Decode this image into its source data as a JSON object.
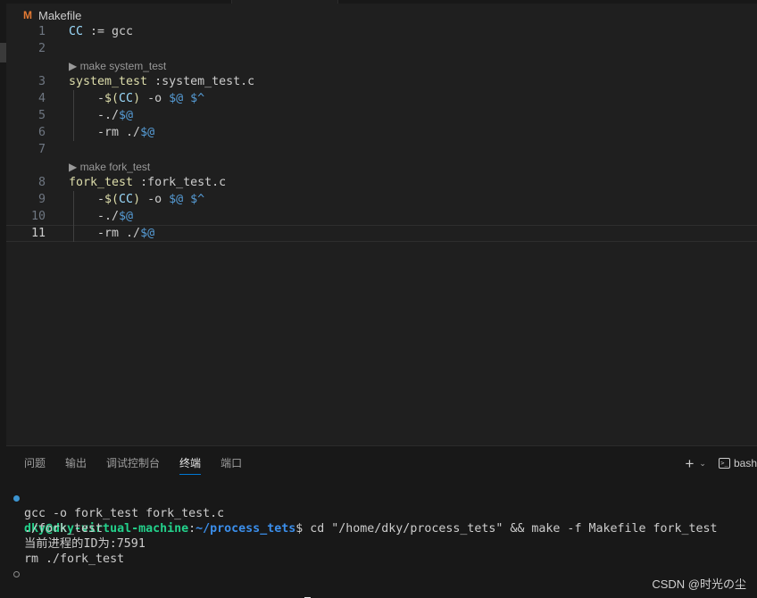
{
  "editor": {
    "file_name": "Makefile",
    "file_icon_letter": "M",
    "lines": [
      {
        "n": "1",
        "segments": [
          {
            "t": "CC",
            "c": "c-blue"
          },
          {
            "t": " := ",
            "c": "c-text"
          },
          {
            "t": "gcc",
            "c": "c-text"
          }
        ]
      },
      {
        "n": "2",
        "segments": []
      },
      {
        "n": "3",
        "lens": "make system_test",
        "segments": [
          {
            "t": "system_test",
            "c": "c-yellow"
          },
          {
            "t": " :",
            "c": "c-text"
          },
          {
            "t": "system_test.c",
            "c": "c-text"
          }
        ]
      },
      {
        "n": "4",
        "segments": [
          {
            "t": "    -",
            "c": "c-dash"
          },
          {
            "t": "$(",
            "c": "c-yellow"
          },
          {
            "t": "CC",
            "c": "c-blue"
          },
          {
            "t": ")",
            "c": "c-yellow"
          },
          {
            "t": " -o ",
            "c": "c-text"
          },
          {
            "t": "$@",
            "c": "c-dblue"
          },
          {
            "t": " ",
            "c": "c-text"
          },
          {
            "t": "$^",
            "c": "c-dblue"
          }
        ]
      },
      {
        "n": "5",
        "segments": [
          {
            "t": "    -",
            "c": "c-dash"
          },
          {
            "t": "./",
            "c": "c-text"
          },
          {
            "t": "$@",
            "c": "c-dblue"
          }
        ]
      },
      {
        "n": "6",
        "segments": [
          {
            "t": "    -",
            "c": "c-dash"
          },
          {
            "t": "rm ./",
            "c": "c-text"
          },
          {
            "t": "$@",
            "c": "c-dblue"
          }
        ]
      },
      {
        "n": "7",
        "segments": []
      },
      {
        "n": "8",
        "lens": "make fork_test",
        "segments": [
          {
            "t": "fork_test",
            "c": "c-yellow"
          },
          {
            "t": " :",
            "c": "c-text"
          },
          {
            "t": "fork_test.c",
            "c": "c-text"
          }
        ]
      },
      {
        "n": "9",
        "segments": [
          {
            "t": "    -",
            "c": "c-dash"
          },
          {
            "t": "$(",
            "c": "c-yellow"
          },
          {
            "t": "CC",
            "c": "c-blue"
          },
          {
            "t": ")",
            "c": "c-yellow"
          },
          {
            "t": " -o ",
            "c": "c-text"
          },
          {
            "t": "$@",
            "c": "c-dblue"
          },
          {
            "t": " ",
            "c": "c-text"
          },
          {
            "t": "$^",
            "c": "c-dblue"
          }
        ]
      },
      {
        "n": "10",
        "segments": [
          {
            "t": "    -",
            "c": "c-dash"
          },
          {
            "t": "./",
            "c": "c-text"
          },
          {
            "t": "$@",
            "c": "c-dblue"
          }
        ]
      },
      {
        "n": "11",
        "current": true,
        "segments": [
          {
            "t": "    -",
            "c": "c-dash"
          },
          {
            "t": "rm ./",
            "c": "c-text"
          },
          {
            "t": "$@",
            "c": "c-dblue"
          }
        ]
      }
    ]
  },
  "panel": {
    "tabs": [
      {
        "label": "问题",
        "active": false
      },
      {
        "label": "输出",
        "active": false
      },
      {
        "label": "调试控制台",
        "active": false
      },
      {
        "label": "终端",
        "active": true
      },
      {
        "label": "端口",
        "active": false
      }
    ],
    "new_terminal_glyph": "+",
    "dropdown_glyph": "⌄",
    "shell_label": "bash"
  },
  "terminal": {
    "prompt_user": "dky@dky-virtual-machine",
    "prompt_sep": ":",
    "prompt_path": "~/process_tets",
    "prompt_end": "$",
    "command": " cd \"/home/dky/process_tets\" && make -f Makefile fork_test",
    "output": [
      "gcc -o fork_test fork_test.c",
      "./fork_test",
      "当前进程的ID为:7591",
      "rm ./fork_test"
    ]
  },
  "watermark": "CSDN @时光の尘",
  "colors": {
    "accent": "#0078d4",
    "prompt_user": "#23d18b",
    "prompt_path": "#3b8eea"
  }
}
